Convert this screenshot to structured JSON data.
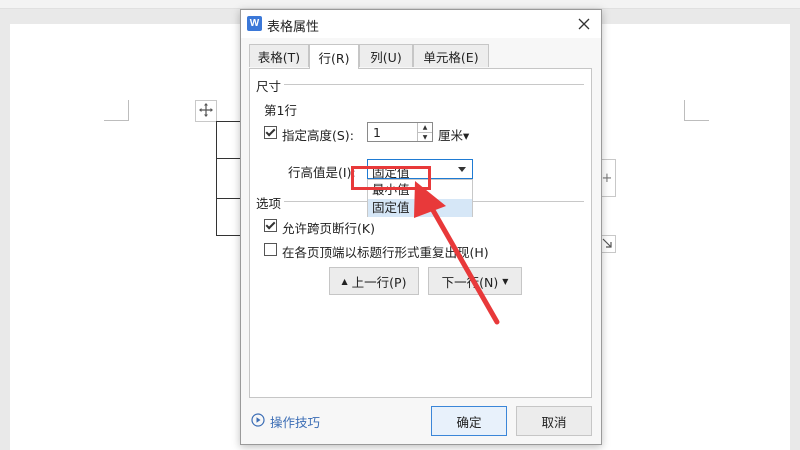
{
  "dialog": {
    "title": "表格属性",
    "app_icon": "W",
    "tabs": [
      {
        "label": "表格(T)",
        "active": false
      },
      {
        "label": "行(R)",
        "active": true
      },
      {
        "label": "列(U)",
        "active": false
      },
      {
        "label": "单元格(E)",
        "active": false
      }
    ],
    "size_section": {
      "heading": "尺寸",
      "row_label": "第1行",
      "specify_height_label": "指定高度(S):",
      "specify_height_checked": true,
      "height_value": "1",
      "unit": "厘米▾",
      "row_height_is_label": "行高值是(I):",
      "row_height_select_value": "固定值",
      "dropdown_options": [
        "最小值",
        "固定值"
      ],
      "dropdown_selected": "固定值"
    },
    "options_section": {
      "heading": "选项",
      "allow_break_label": "允许跨页断行(K)",
      "allow_break_checked": true,
      "repeat_header_label": "在各页顶端以标题行形式重复出现(H)",
      "repeat_header_checked": false
    },
    "nav": {
      "prev_row": "上一行(P)",
      "next_row": "下一行(N)"
    },
    "footer": {
      "tips": "操作技巧",
      "ok": "确定",
      "cancel": "取消"
    }
  },
  "annotation": {
    "highlight_color": "#e8393a"
  },
  "icons": [
    "move-icon",
    "close-icon",
    "spin-up-icon",
    "spin-down-icon",
    "dropdown-arrow-icon",
    "play-circle-icon",
    "resize-icon",
    "plus-icon"
  ]
}
